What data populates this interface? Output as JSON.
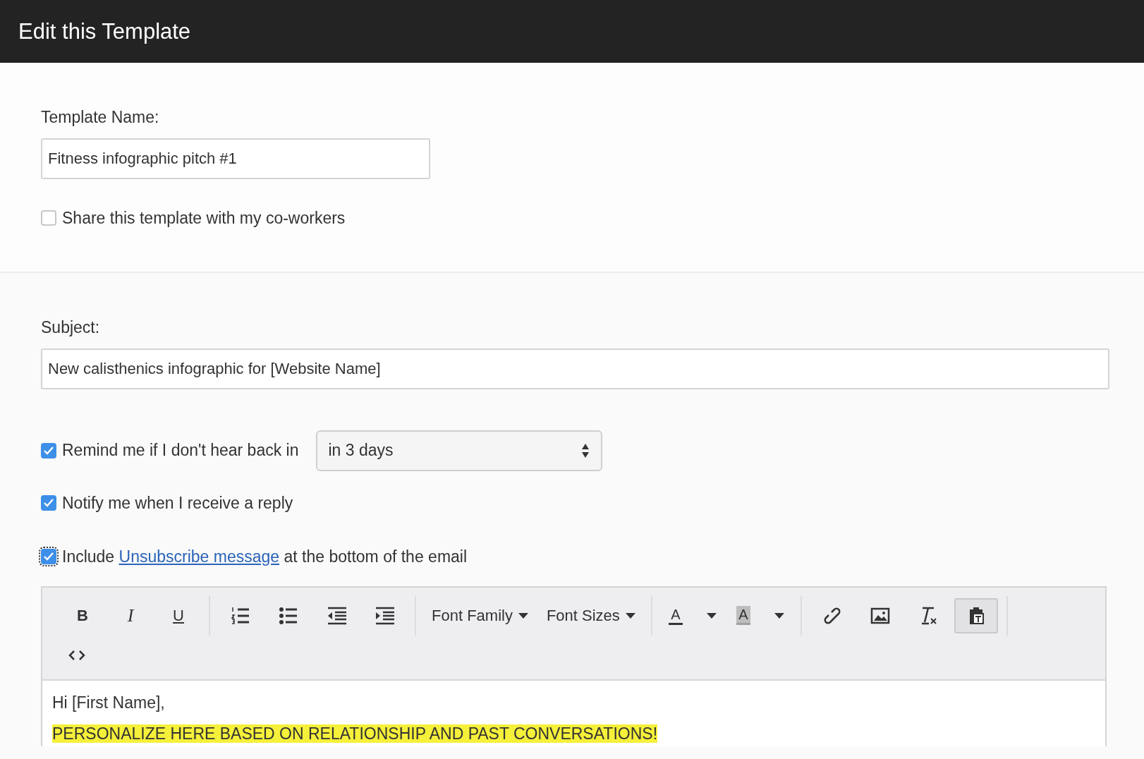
{
  "header": {
    "title": "Edit this Template"
  },
  "template_name": {
    "label": "Template Name:",
    "value": "Fitness infographic pitch #1"
  },
  "share": {
    "label": "Share this template with my co-workers",
    "checked": false
  },
  "subject": {
    "label": "Subject:",
    "value": "New calisthenics infographic for [Website Name]"
  },
  "options": [
    {
      "kind": "select",
      "label": "Remind me if I don't hear back in",
      "checked": true,
      "select_value": "in 3 days"
    },
    {
      "kind": "plain",
      "label": "Notify me when I receive a reply",
      "checked": true
    },
    {
      "kind": "link",
      "before": "Include",
      "link": "Unsubscribe message",
      "after": "at the bottom of the email",
      "checked": true,
      "focused": true
    }
  ],
  "toolbar": [
    [
      {
        "kind": "bold",
        "label": "B",
        "selected": false
      },
      {
        "kind": "italic",
        "label": "I",
        "selected": false
      },
      {
        "kind": "underline",
        "label": "U",
        "selected": false
      }
    ],
    [
      {
        "kind": "ordered",
        "selected": false
      },
      {
        "kind": "bullets",
        "selected": false
      },
      {
        "kind": "outdent",
        "selected": false
      },
      {
        "kind": "indent",
        "selected": false
      }
    ],
    [
      {
        "kind": "dropdown",
        "label": "Font Family",
        "selected": false
      },
      {
        "kind": "dropdown",
        "label": "Font Sizes",
        "selected": false
      }
    ],
    [
      {
        "kind": "color",
        "label": "A",
        "color": "#333333",
        "selected": false
      },
      {
        "kind": "background",
        "label": "A",
        "color": "#a0a0a0",
        "selected": false
      }
    ],
    [
      {
        "kind": "link",
        "selected": false
      },
      {
        "kind": "image",
        "selected": false
      },
      {
        "kind": "clear",
        "selected": false
      },
      {
        "kind": "paste",
        "selected": true
      }
    ],
    [
      {
        "kind": "code",
        "selected": false
      }
    ]
  ],
  "body": [
    {
      "text": "Hi [First Name],",
      "highlight": false
    },
    {
      "text": "PERSONALIZE HERE BASED ON RELATIONSHIP AND PAST CONVERSATIONS!",
      "highlight": true
    }
  ]
}
